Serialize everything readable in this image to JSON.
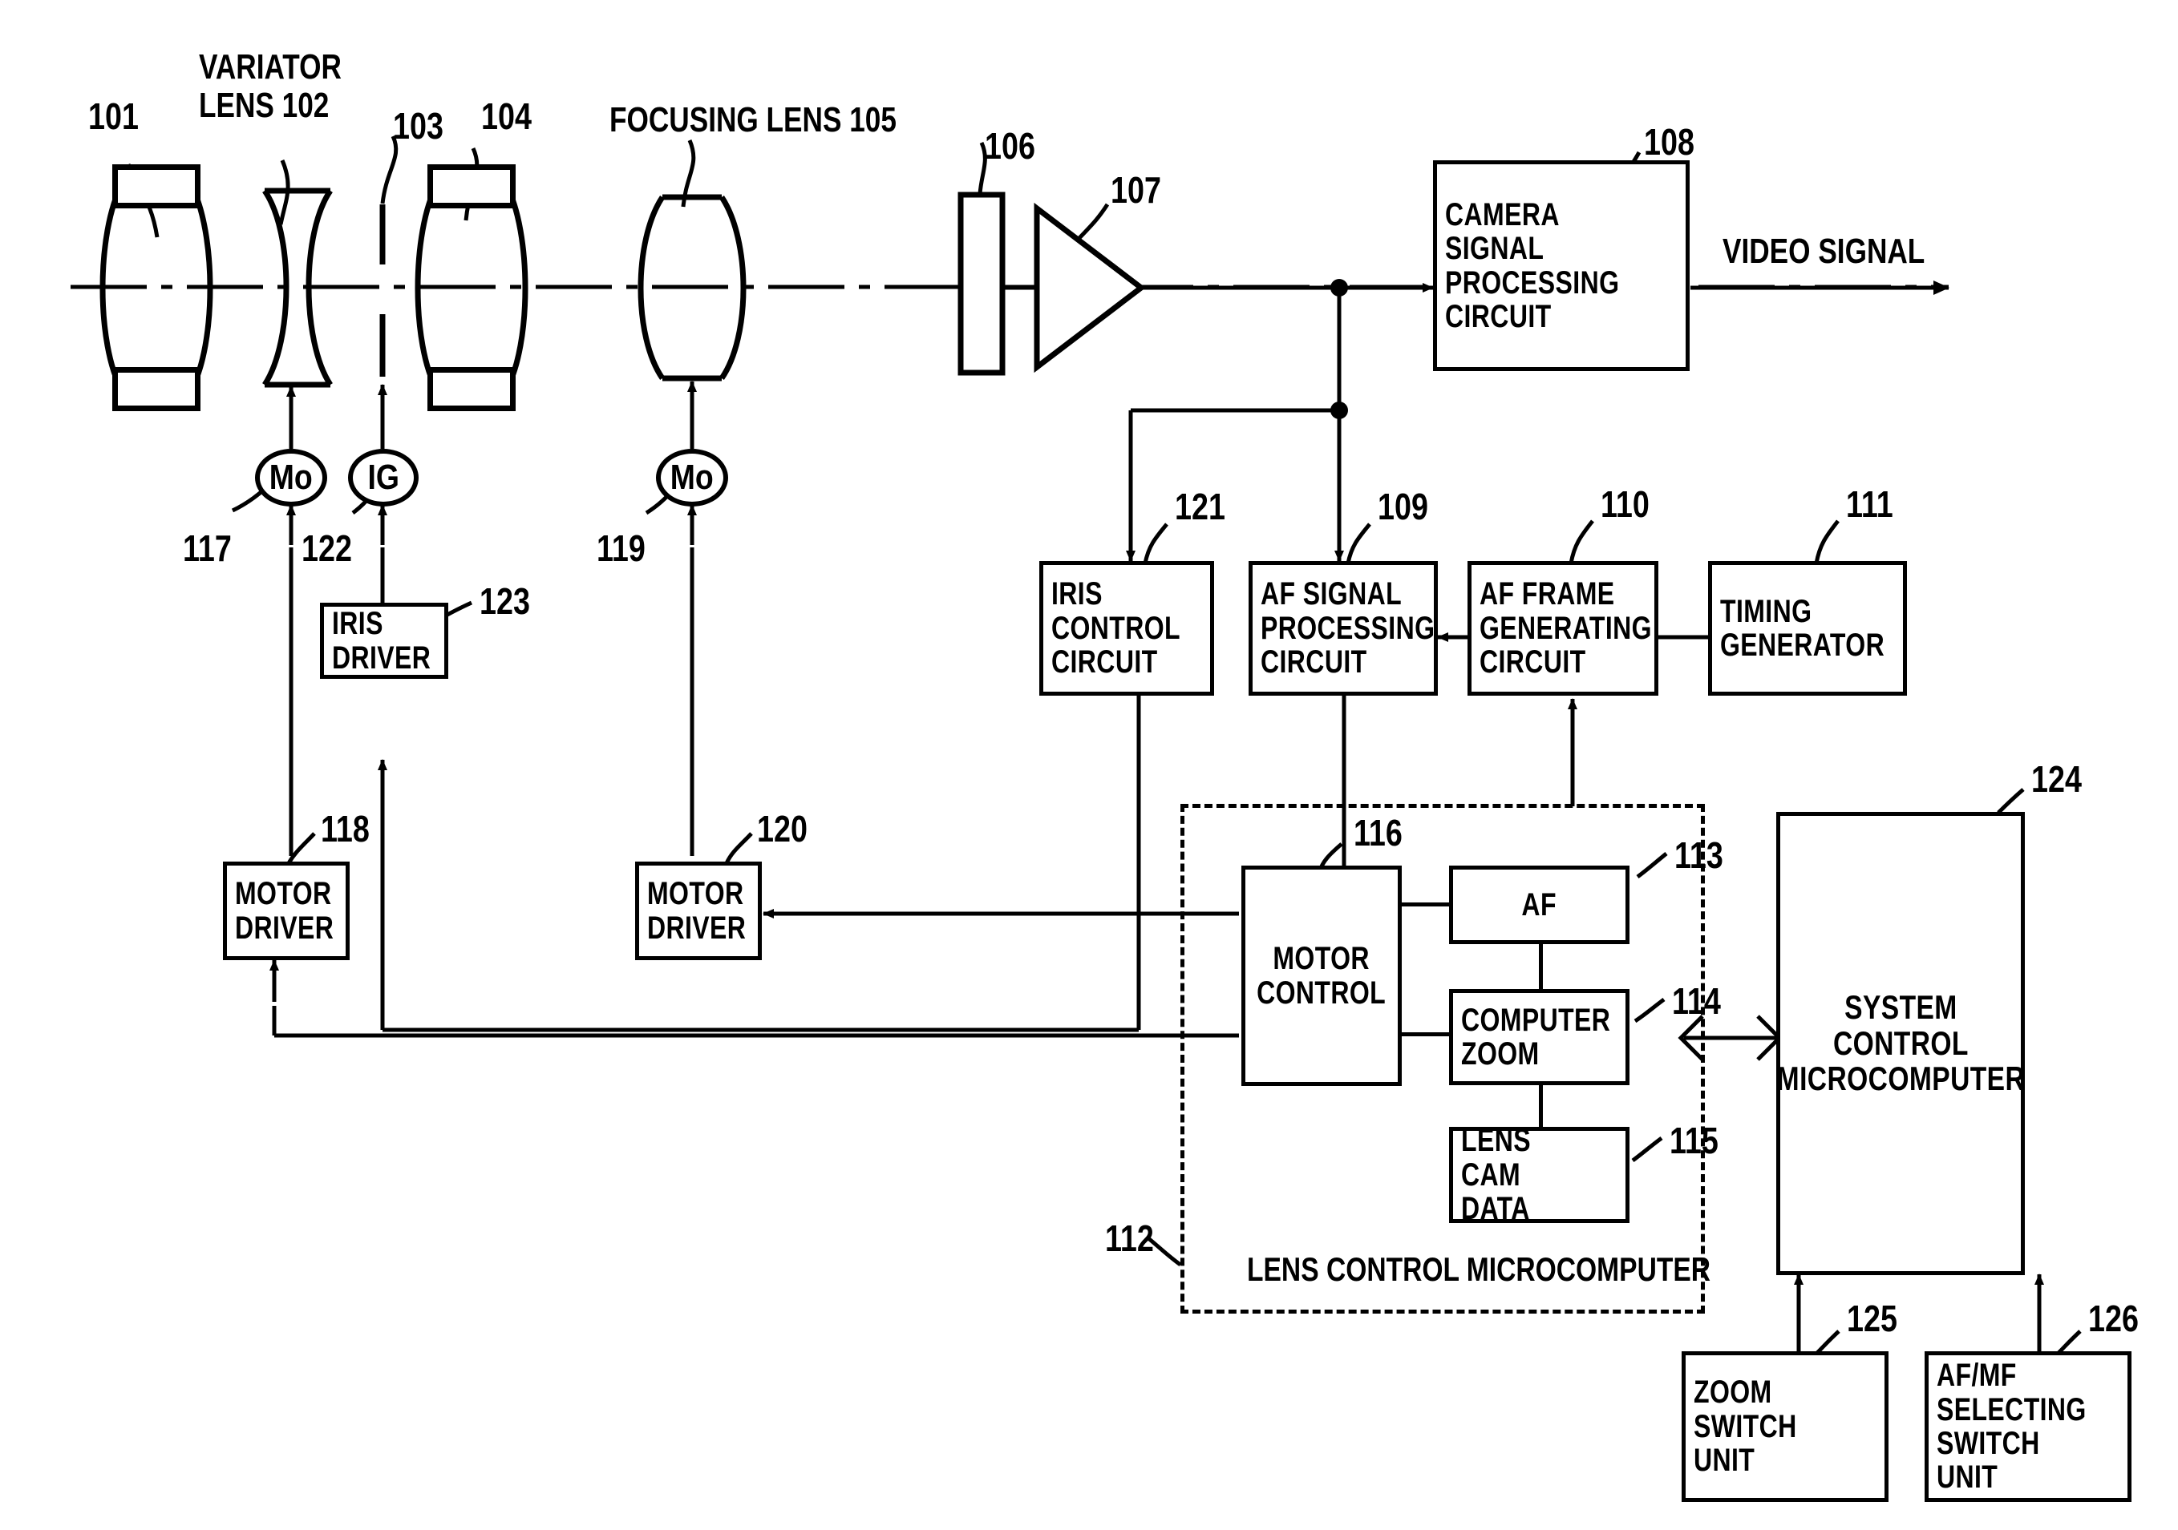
{
  "figure": {
    "title": "Camera lens control system block diagram",
    "video_signal_label": "VIDEO SIGNAL"
  },
  "optics": {
    "labels": [
      {
        "ref": "101",
        "name": "front-lens"
      },
      {
        "ref": "102",
        "name": "variator-lens",
        "caption": "VARIATOR\nLENS 102"
      },
      {
        "ref": "103",
        "name": "iris"
      },
      {
        "ref": "104",
        "name": "relay-lens"
      },
      {
        "ref": "105",
        "name": "focusing-lens",
        "caption": "FOCUSING LENS 105"
      },
      {
        "ref": "106",
        "name": "image-sensor"
      },
      {
        "ref": "107",
        "name": "amplifier"
      }
    ],
    "ref_101": "101",
    "ref_102_caption": "VARIATOR\nLENS 102",
    "ref_103": "103",
    "ref_104": "104",
    "ref_105_caption": "FOCUSING LENS 105",
    "ref_106": "106",
    "ref_107": "107"
  },
  "actuators": {
    "zoom_motor": "Mo",
    "zoom_motor_ref": "117",
    "iris_motor": "IG",
    "iris_motor_ref": "122",
    "focus_motor": "Mo",
    "focus_motor_ref": "119",
    "iris_driver": "IRIS\nDRIVER",
    "iris_driver_ref": "123",
    "zoom_motor_driver": "MOTOR\nDRIVER",
    "zoom_motor_driver_ref": "118",
    "focus_motor_driver": "MOTOR\nDRIVER",
    "focus_motor_driver_ref": "120"
  },
  "circuits": {
    "camera_signal": "CAMERA SIGNAL\nPROCESSING\nCIRCUIT",
    "camera_signal_ref": "108",
    "iris_control": "IRIS\nCONTROL\nCIRCUIT",
    "iris_control_ref": "121",
    "af_signal": "AF SIGNAL\nPROCESSING\nCIRCUIT",
    "af_signal_ref": "109",
    "af_frame": "AF FRAME\nGENERATING\nCIRCUIT",
    "af_frame_ref": "110",
    "timing_generator": "TIMING\nGENERATOR",
    "timing_generator_ref": "111"
  },
  "lens_mcu": {
    "title": "LENS CONTROL MICROCOMPUTER",
    "ref": "112",
    "motor_control": "MOTOR\nCONTROL",
    "motor_control_ref": "116",
    "af": "AF",
    "af_ref": "113",
    "computer_zoom": "COMPUTER\nZOOM",
    "computer_zoom_ref": "114",
    "lens_cam_data": "LENS\nCAM DATA",
    "lens_cam_data_ref": "115"
  },
  "system": {
    "system_mcu": "SYSTEM CONTROL\nMICROCOMPUTER",
    "system_mcu_ref": "124",
    "zoom_switch": "ZOOM\nSWITCH UNIT",
    "zoom_switch_ref": "125",
    "afmf_switch": "AF/MF\nSELECTING\nSWITCH UNIT",
    "afmf_switch_ref": "126"
  },
  "colors": {
    "ink": "#000000",
    "paper": "#ffffff"
  }
}
